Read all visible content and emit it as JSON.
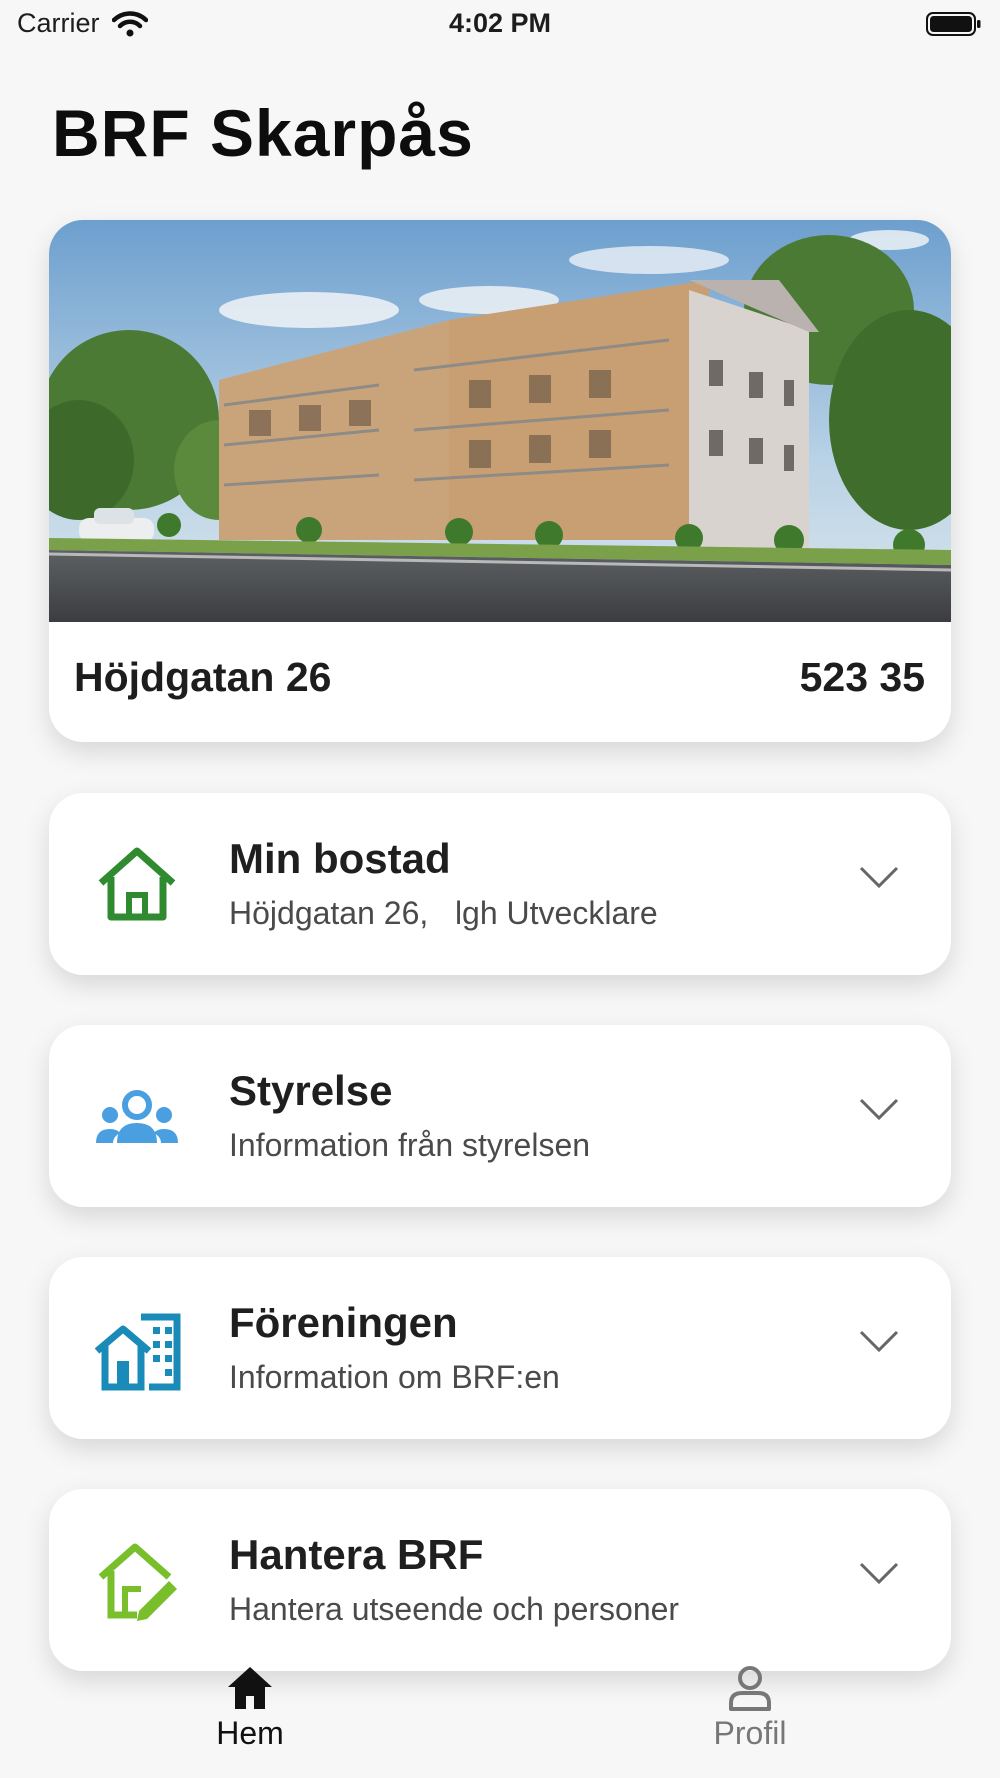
{
  "status_bar": {
    "carrier": "Carrier",
    "time": "4:02 PM"
  },
  "page": {
    "title": "BRF Skarpås"
  },
  "hero": {
    "address": "Höjdgatan 26",
    "zip": "523 35",
    "image": "apartment-building-rendering"
  },
  "menu": [
    {
      "title": "Min bostad",
      "subtitle": "Höjdgatan 26,   lgh Utvecklare",
      "icon": "house-icon",
      "color": "#2f8a30"
    },
    {
      "title": "Styrelse",
      "subtitle": "Information från styrelsen",
      "icon": "group-icon",
      "color": "#4a9fe0"
    },
    {
      "title": "Föreningen",
      "subtitle": "Information om BRF:en",
      "icon": "buildings-icon",
      "color": "#1a8bb8"
    },
    {
      "title": "Hantera BRF",
      "subtitle": "Hantera utseende och personer",
      "icon": "house-edit-icon",
      "color": "#79bf2c"
    }
  ],
  "tabs": [
    {
      "label": "Hem",
      "icon": "home-icon",
      "active": true
    },
    {
      "label": "Profil",
      "icon": "person-icon",
      "active": false
    }
  ],
  "colors": {
    "active_tab": "#111111",
    "inactive_tab": "#777777",
    "background": "#f7f7f7"
  }
}
